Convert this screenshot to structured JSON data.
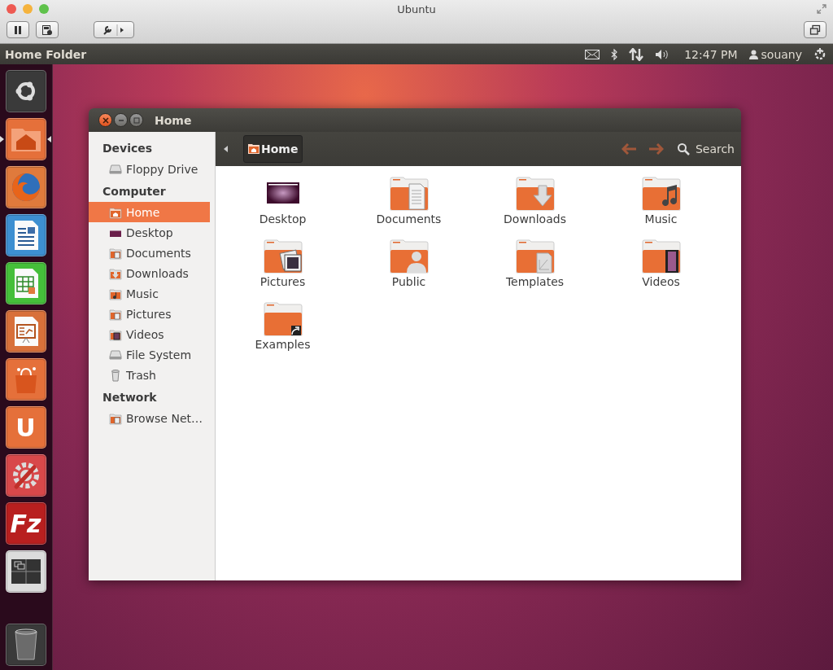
{
  "host_window": {
    "title": "Ubuntu"
  },
  "top_panel": {
    "app_title": "Home Folder",
    "clock": "12:47 PM",
    "user": "souany"
  },
  "launcher": [
    {
      "kind": "dash",
      "active": false
    },
    {
      "kind": "files",
      "active": true
    },
    {
      "kind": "browser",
      "active": false
    },
    {
      "kind": "writer",
      "active": false
    },
    {
      "kind": "calc",
      "active": false
    },
    {
      "kind": "impress",
      "active": false
    },
    {
      "kind": "store",
      "active": false
    },
    {
      "kind": "cloud",
      "active": false,
      "glyph": "U"
    },
    {
      "kind": "settings",
      "active": false
    },
    {
      "kind": "ftp",
      "active": false,
      "glyph": "Fz"
    },
    {
      "kind": "workspaces",
      "active": false
    },
    {
      "kind": "trash",
      "active": false
    }
  ],
  "file_window": {
    "title": "Home",
    "sidebar": [
      {
        "heading": "Devices",
        "items": [
          {
            "label": "Floppy Drive",
            "kind": "drive",
            "selected": false
          }
        ]
      },
      {
        "heading": "Computer",
        "items": [
          {
            "label": "Home",
            "kind": "home",
            "selected": true
          },
          {
            "label": "Desktop",
            "kind": "desktop",
            "selected": false
          },
          {
            "label": "Documents",
            "kind": "documents",
            "selected": false
          },
          {
            "label": "Downloads",
            "kind": "downloads",
            "selected": false
          },
          {
            "label": "Music",
            "kind": "music",
            "selected": false
          },
          {
            "label": "Pictures",
            "kind": "pictures",
            "selected": false
          },
          {
            "label": "Videos",
            "kind": "videos",
            "selected": false
          },
          {
            "label": "File System",
            "kind": "drive",
            "selected": false
          },
          {
            "label": "Trash",
            "kind": "trash",
            "selected": false
          }
        ]
      },
      {
        "heading": "Network",
        "items": [
          {
            "label": "Browse Net…",
            "kind": "network",
            "selected": false
          }
        ]
      }
    ],
    "path_button": "Home",
    "search_label": "Search",
    "files": [
      {
        "name": "Desktop",
        "kind": "desktop"
      },
      {
        "name": "Documents",
        "kind": "documents"
      },
      {
        "name": "Downloads",
        "kind": "downloads"
      },
      {
        "name": "Music",
        "kind": "music"
      },
      {
        "name": "Pictures",
        "kind": "pictures"
      },
      {
        "name": "Public",
        "kind": "public"
      },
      {
        "name": "Templates",
        "kind": "templates"
      },
      {
        "name": "Videos",
        "kind": "videos"
      },
      {
        "name": "Examples",
        "kind": "examples"
      }
    ]
  }
}
